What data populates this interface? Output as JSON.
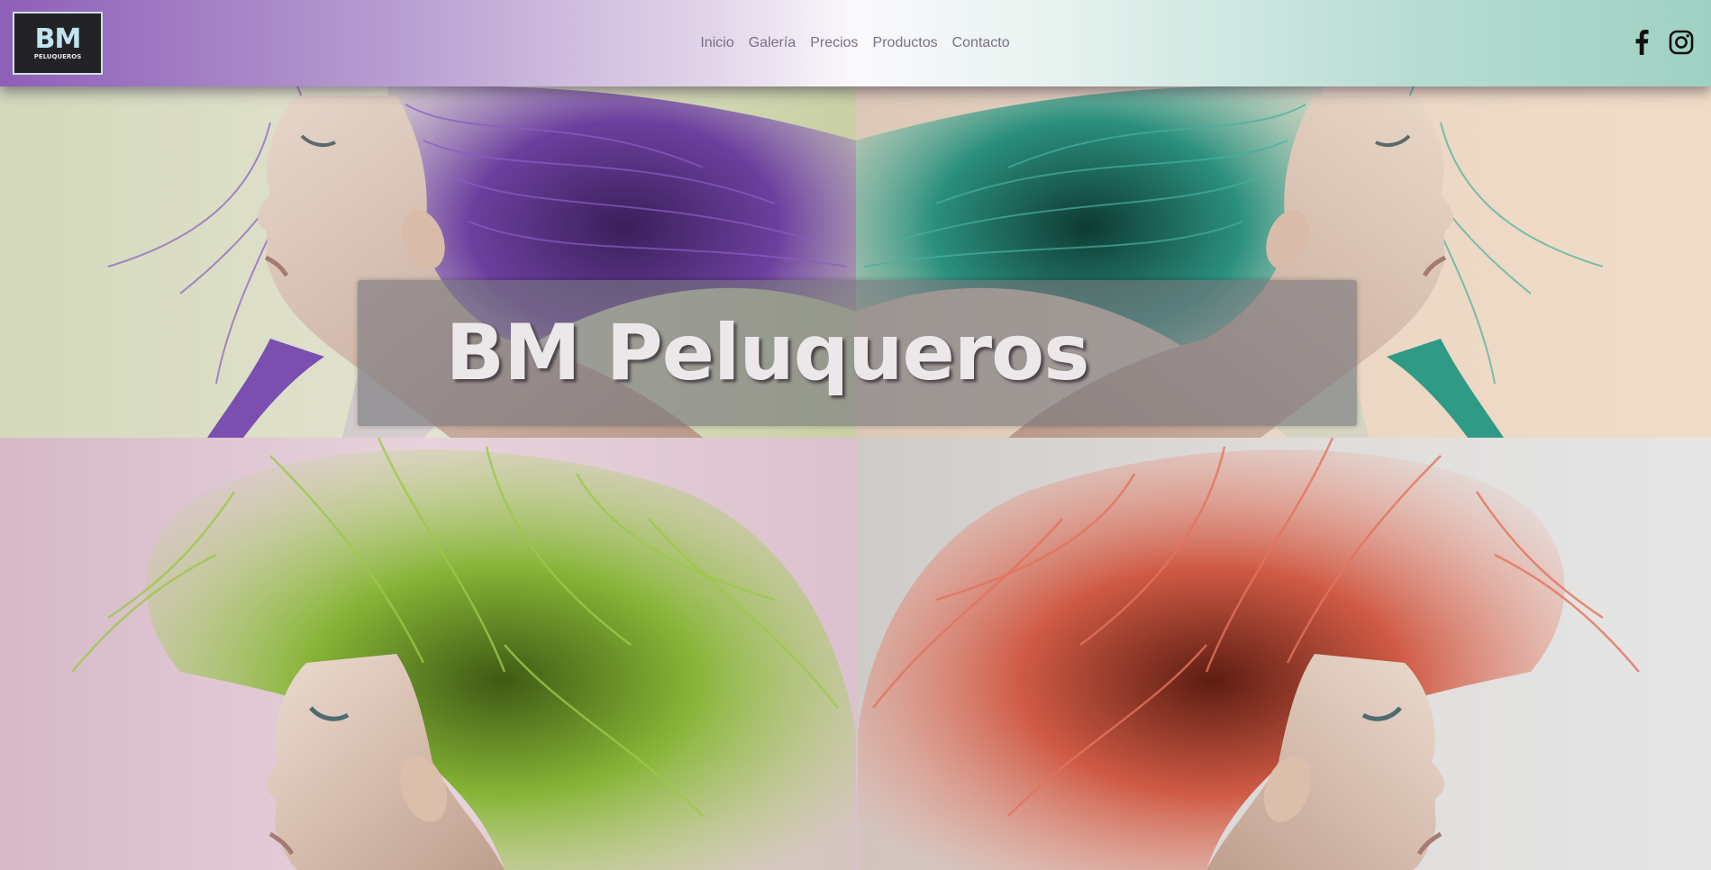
{
  "logo": {
    "main": "BM",
    "sub": "PELUQUEROS"
  },
  "nav": {
    "items": [
      {
        "label": "Inicio"
      },
      {
        "label": "Galería"
      },
      {
        "label": "Precios"
      },
      {
        "label": "Productos"
      },
      {
        "label": "Contacto"
      }
    ]
  },
  "social": {
    "facebook_icon": "facebook-icon",
    "instagram_icon": "instagram-icon"
  },
  "hero": {
    "title": "BM Peluqueros",
    "tiles": [
      {
        "hair_color": "#7a4fb0",
        "background": "#d9dcc0"
      },
      {
        "hair_color": "#2f9a86",
        "background": "#ecd9c4"
      },
      {
        "hair_color": "#8bb83a",
        "background": "#dcc2cf"
      },
      {
        "hair_color": "#d9654f",
        "background": "#dcdad7"
      }
    ]
  },
  "colors": {
    "header_left": "#8e5fb8",
    "header_center": "#fbf9fc",
    "header_right": "#9fd1c3",
    "nav_text": "#7a6f86"
  }
}
